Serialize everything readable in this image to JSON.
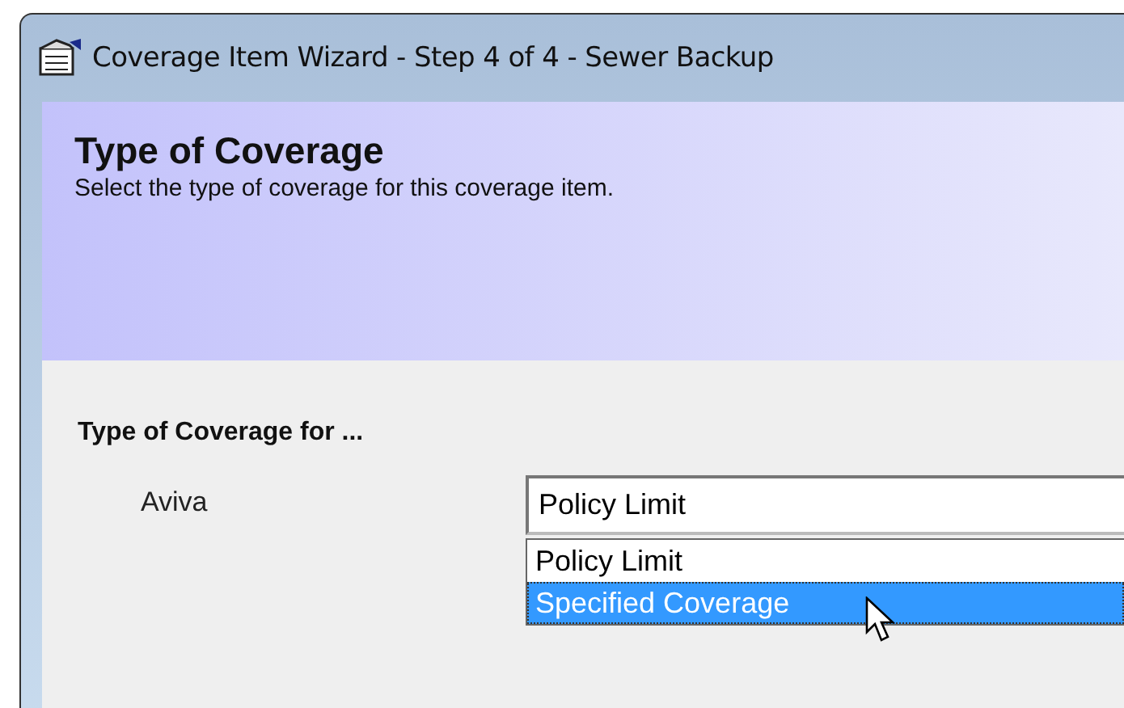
{
  "window": {
    "title": "Coverage Item Wizard - Step 4 of 4 - Sewer Backup"
  },
  "header": {
    "title": "Type of Coverage",
    "subtitle": "Select the type of coverage for this coverage item."
  },
  "section": {
    "title": "Type of Coverage for ..."
  },
  "fields": [
    {
      "label": "Aviva",
      "value": "Policy Limit",
      "expanded": true,
      "options": [
        {
          "label": "Policy Limit",
          "highlighted": false
        },
        {
          "label": "Specified Coverage",
          "highlighted": true
        }
      ]
    }
  ]
}
